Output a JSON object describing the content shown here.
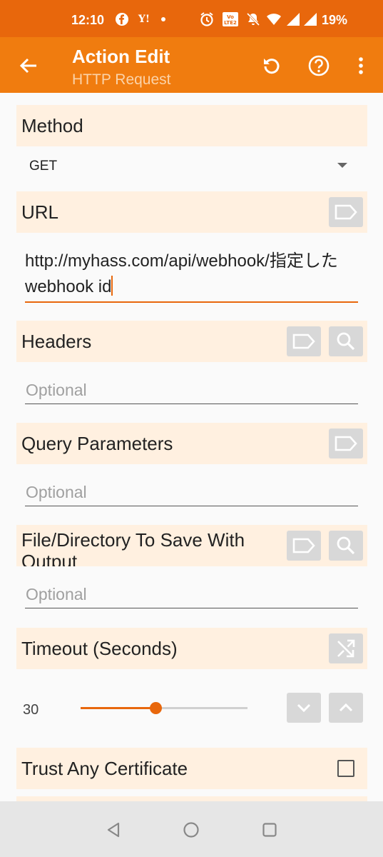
{
  "status_bar": {
    "time": "12:10",
    "battery": "19%",
    "left_icons": [
      "facebook-icon",
      "yahoo-icon",
      "dot-icon"
    ],
    "right_icons": [
      "alarm-icon",
      "volte-icon",
      "mute-icon",
      "wifi-icon",
      "signal-icon"
    ]
  },
  "app_bar": {
    "title": "Action Edit",
    "subtitle": "HTTP Request",
    "actions": [
      "undo-icon",
      "help-icon",
      "more-vert-icon"
    ]
  },
  "form": {
    "method": {
      "label": "Method",
      "value": "GET"
    },
    "url": {
      "label": "URL",
      "value": "http://myhass.com/api/webhook/指定したwebhook id"
    },
    "headers": {
      "label": "Headers",
      "placeholder": "Optional"
    },
    "query_parameters": {
      "label": "Query Parameters",
      "placeholder": "Optional"
    },
    "file_directory": {
      "label": "File/Directory To Save With Output",
      "placeholder": "Optional"
    },
    "timeout": {
      "label": "Timeout (Seconds)",
      "value": "30",
      "slider_fraction": 0.45
    },
    "trust_certificate": {
      "label": "Trust Any Certificate",
      "checked": false
    }
  },
  "colors": {
    "accent": "#e8670c",
    "app_bar": "#f07c0f",
    "section_bg": "#fff0e0",
    "button_bg": "#d8d8d8"
  },
  "nav_bar": {
    "buttons": [
      "back-triangle-icon",
      "home-circle-icon",
      "recents-square-icon"
    ]
  }
}
